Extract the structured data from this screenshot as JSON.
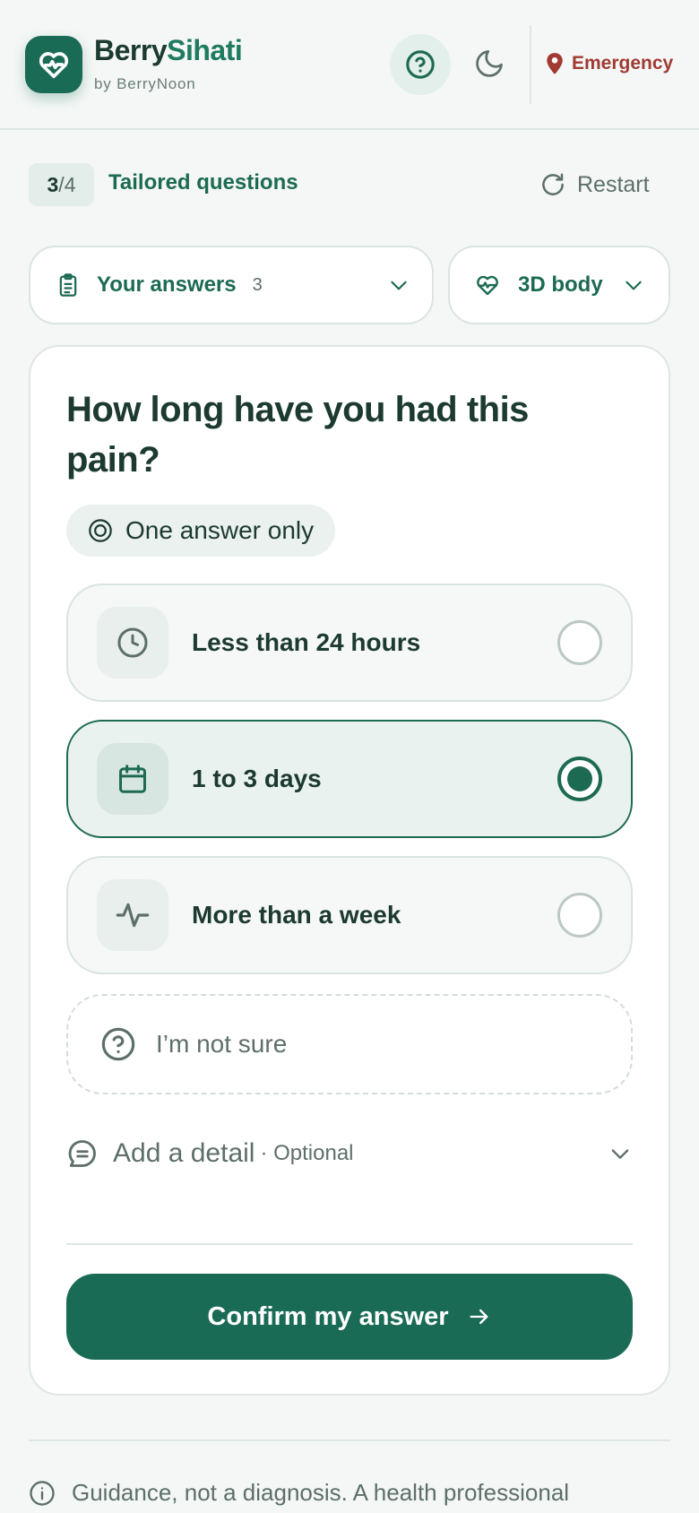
{
  "header": {
    "brand_primary": "Berry",
    "brand_accent": "Sihati",
    "brand_sub": "by BerryNoon",
    "help_icon": "help-circle-icon",
    "theme_icon": "moon-icon",
    "emergency_label": "Emergency",
    "emergency_icon": "map-pin-icon"
  },
  "progress": {
    "current": "3",
    "separator": "/",
    "total": "4",
    "title": "Tailored questions",
    "restart_label": "Restart"
  },
  "toggles": {
    "answers_label": "Your answers",
    "answers_count": "3",
    "body_label": "3D body"
  },
  "question": {
    "text": "How long have you had this pain?",
    "mode_label": "One answer only",
    "options": [
      {
        "label": "Less than 24 hours",
        "icon": "clock-icon",
        "selected": false
      },
      {
        "label": "1 to 3 days",
        "icon": "calendar-icon",
        "selected": true
      },
      {
        "label": "More than a week",
        "icon": "activity-icon",
        "selected": false
      }
    ],
    "unsure_label": "I’m not sure",
    "detail_label": "Add a detail",
    "detail_optional": "· Optional",
    "confirm_label": "Confirm my answer"
  },
  "footer": {
    "disclaimer": "Guidance, not a diagnosis. A health professional"
  },
  "colors": {
    "primary": "#1a6b56",
    "accent_text": "#1d6a53",
    "emergency": "#a03a33",
    "background": "#f4f7f5"
  }
}
